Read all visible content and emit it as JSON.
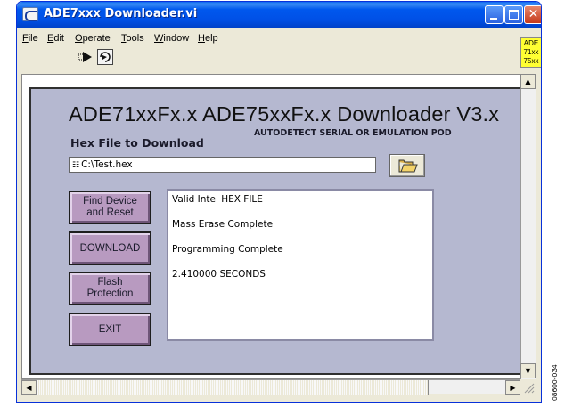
{
  "window": {
    "title": "ADE7xxx Downloader.vi",
    "controls": {
      "minimize": "minimize",
      "maximize": "maximize",
      "close": "✕"
    }
  },
  "menu": {
    "items": [
      {
        "u": "F",
        "rest": "ile"
      },
      {
        "u": "E",
        "rest": "dit"
      },
      {
        "u": "O",
        "rest": "perate"
      },
      {
        "u": "T",
        "rest": "ools"
      },
      {
        "u": "W",
        "rest": "indow"
      },
      {
        "u": "H",
        "rest": "elp"
      }
    ]
  },
  "toolbar": {
    "run_icon": "run-arrow-icon",
    "continuous_icon": "continuous-run-icon"
  },
  "badge": {
    "line1": "ADE",
    "line2": "71xx",
    "line3": "75xx"
  },
  "panel": {
    "heading": "ADE71xxFx.x ADE75xxFx.x Downloader V3.x",
    "hex_label": "Hex File to Download",
    "autodetect_label": "AUTODETECT SERIAL OR EMULATION POD",
    "file_path": "C:\\Test.hex",
    "browse_icon": "folder-icon",
    "buttons": {
      "find": "Find Device and Reset",
      "download": "DOWNLOAD",
      "flash": "Flash Protection",
      "exit": "EXIT"
    },
    "status_lines": [
      "Valid Intel HEX FILE",
      "Mass Erase Complete",
      "Programming Complete",
      "2.410000 SECONDS"
    ]
  },
  "figure_id": "08600-034",
  "colors": {
    "titlebar": "#0058ee",
    "panel": "#b5b8d0",
    "buttons": "#b89ac0",
    "badge": "#ffff33"
  }
}
